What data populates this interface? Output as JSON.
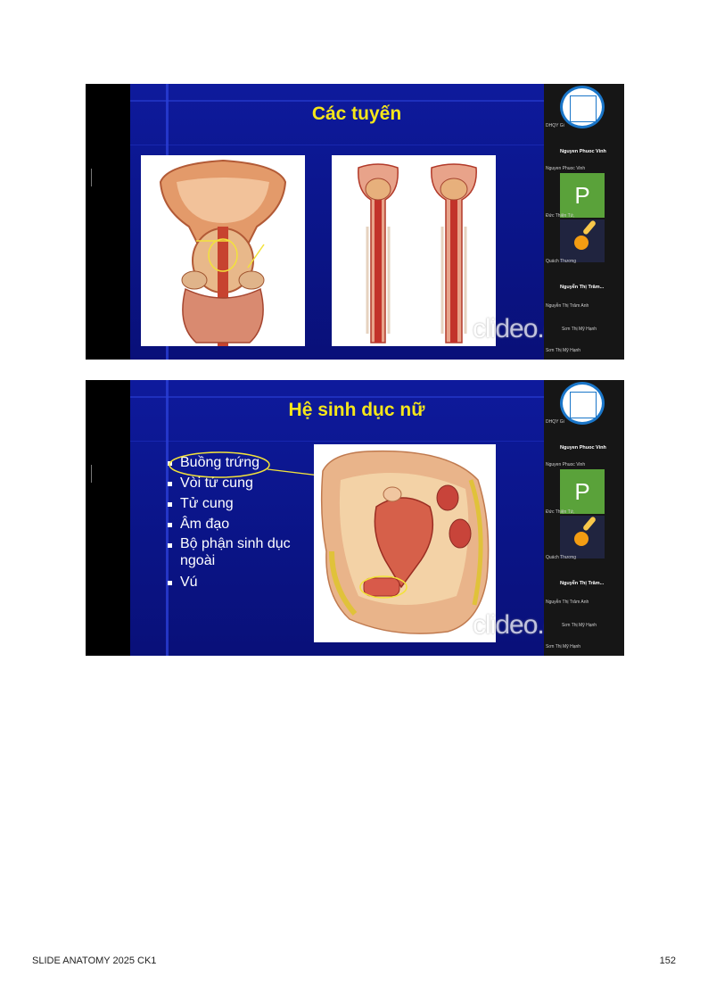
{
  "slides": [
    {
      "title": "Các tuyến",
      "watermark": "clideo.com",
      "panel": {
        "logo_caption": "DHQY Gi",
        "names": [
          "Nguyen Phuoc Vinh",
          "Nguyen Phuoc Vinh",
          "Đức Thiện Tứ,",
          "Quách Thương",
          "Nguyễn Thị Trâm...",
          "Nguyễn Thị Trâm Anh",
          "Sơn Thị Mỹ Hạnh",
          "Sơn Thị Mỹ Hạnh"
        ],
        "avatar_letter": "P"
      }
    },
    {
      "title": "Hệ sinh dục nữ",
      "watermark": "clideo.com",
      "bullets": [
        "Buồng trứng",
        "Vòi tử cung",
        "Tử cung",
        "Âm đạo",
        "Bộ phận sinh dục ngoài",
        "Vú"
      ],
      "panel": {
        "logo_caption": "DHQY Gi",
        "names": [
          "Nguyen Phuoc Vinh",
          "Nguyen Phuoc Vinh",
          "Đức Thiện Tứ,",
          "Quách Thương",
          "Nguyễn Thị Trâm...",
          "Nguyễn Thị Trâm Anh",
          "Sơn Thị Mỹ Hạnh",
          "Sơn Thị Mỹ Hạnh"
        ],
        "avatar_letter": "P"
      }
    }
  ],
  "footer": {
    "left": "SLIDE ANATOMY 2025 CK1",
    "right": "152"
  },
  "colors": {
    "slide_bg": "#0e1a9c",
    "title": "#f5e61a",
    "annotation": "#f2e23a",
    "avatar_green": "#5aa23a"
  },
  "icons": [
    "university-logo-icon",
    "meteor-avatar-icon"
  ]
}
